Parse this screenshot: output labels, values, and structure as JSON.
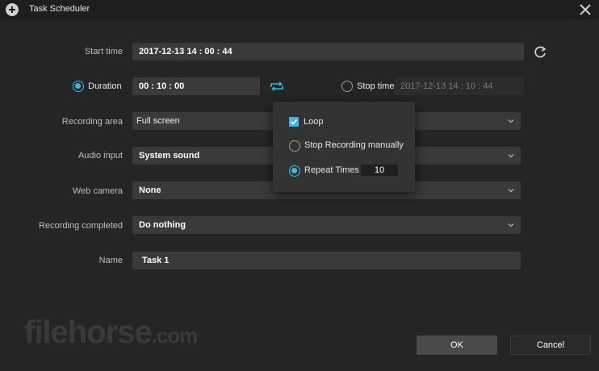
{
  "window": {
    "title": "Task Scheduler"
  },
  "start_time": {
    "label": "Start time",
    "value": "2017-12-13 14 : 00 : 44"
  },
  "duration": {
    "label": "Duration",
    "value": "00 : 10 : 00",
    "selected": true
  },
  "stop_time": {
    "label": "Stop time",
    "value": "2017-12-13 14 : 10 : 44",
    "selected": false
  },
  "recording_area": {
    "label": "Recording area",
    "value": "Full screen"
  },
  "audio_input": {
    "label": "Audio input",
    "value": "System sound"
  },
  "web_camera": {
    "label": "Web camera",
    "value": "None"
  },
  "recording_completed": {
    "label": "Recording completed",
    "value": "Do nothing"
  },
  "name": {
    "label": "Name",
    "value": "Task 1"
  },
  "popup": {
    "loop_label": "Loop",
    "loop_checked": true,
    "stop_manually_label": "Stop Recording manually",
    "repeat_label": "Repeat Times",
    "repeat_value": "10",
    "selected": "repeat"
  },
  "buttons": {
    "ok": "OK",
    "cancel": "Cancel"
  },
  "watermark": {
    "main": "filehorse",
    "suffix": ".com"
  },
  "colors": {
    "accent": "#3fb8e8",
    "background": "#252525",
    "field": "#3a3a3a"
  }
}
